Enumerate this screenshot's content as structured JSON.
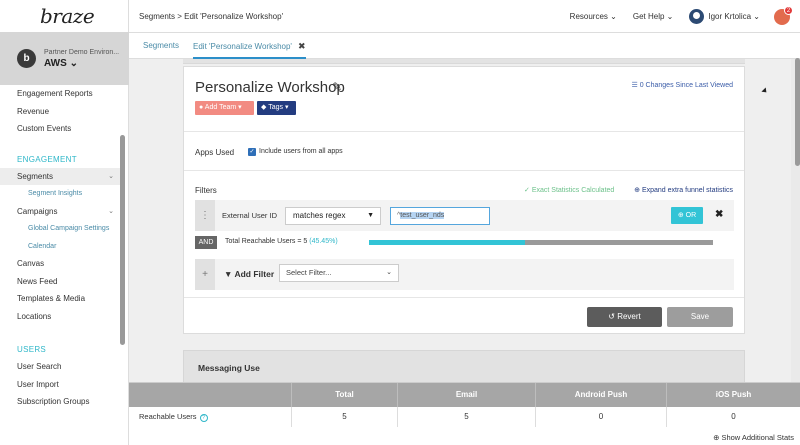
{
  "app": {
    "logo": "braze"
  },
  "workspace": {
    "env": "Partner Demo Environ...",
    "name": "AWS",
    "badge": "b"
  },
  "sidebar": {
    "items_top": [
      "Engagement Reports",
      "Revenue",
      "Custom Events"
    ],
    "section_engagement": "ENGAGEMENT",
    "segments": "Segments",
    "segment_insights": "Segment Insights",
    "campaigns": "Campaigns",
    "global_campaign_settings": "Global Campaign Settings",
    "calendar": "Calendar",
    "items_mid": [
      "Canvas",
      "News Feed",
      "Templates & Media",
      "Locations"
    ],
    "section_users": "USERS",
    "items_users": [
      "User Search",
      "User Import",
      "Subscription Groups"
    ]
  },
  "topbar": {
    "breadcrumb": "Segments > Edit 'Personalize Workshop'",
    "resources": "Resources",
    "get_help": "Get Help",
    "user_name": "Igor Krtolica",
    "notif_count": "2"
  },
  "tabs": {
    "segments": "Segments",
    "edit": "Edit 'Personalize Workshop'"
  },
  "segment": {
    "title": "Personalize Workshop",
    "changes": "0 Changes Since Last Viewed",
    "add_team": "Add Team",
    "tags": "Tags",
    "apps_used_label": "Apps Used",
    "include_all_apps": "Include users from all apps",
    "filters_label": "Filters",
    "exact_stats": "Exact Statistics Calculated",
    "expand_stats": "Expand extra funnel statistics",
    "filter": {
      "attribute": "External User ID",
      "operator": "matches regex",
      "value": "test_user_nds",
      "value_prefix": "^",
      "or_label": "OR"
    },
    "and_label": "AND",
    "reach_text": "Total Reachable Users = 5",
    "reach_pct": "(45.45%)",
    "reach_fraction": 0.4545,
    "add_filter": "Add Filter",
    "select_filter_placeholder": "Select Filter...",
    "revert": "Revert",
    "save": "Save"
  },
  "messaging": {
    "label": "Messaging Use"
  },
  "stats": {
    "headers": [
      "Total",
      "Email",
      "Android Push",
      "iOS Push"
    ],
    "row_label": "Reachable Users",
    "values": [
      "5",
      "5",
      "0",
      "0"
    ],
    "show_more": "Show Additional Stats"
  }
}
